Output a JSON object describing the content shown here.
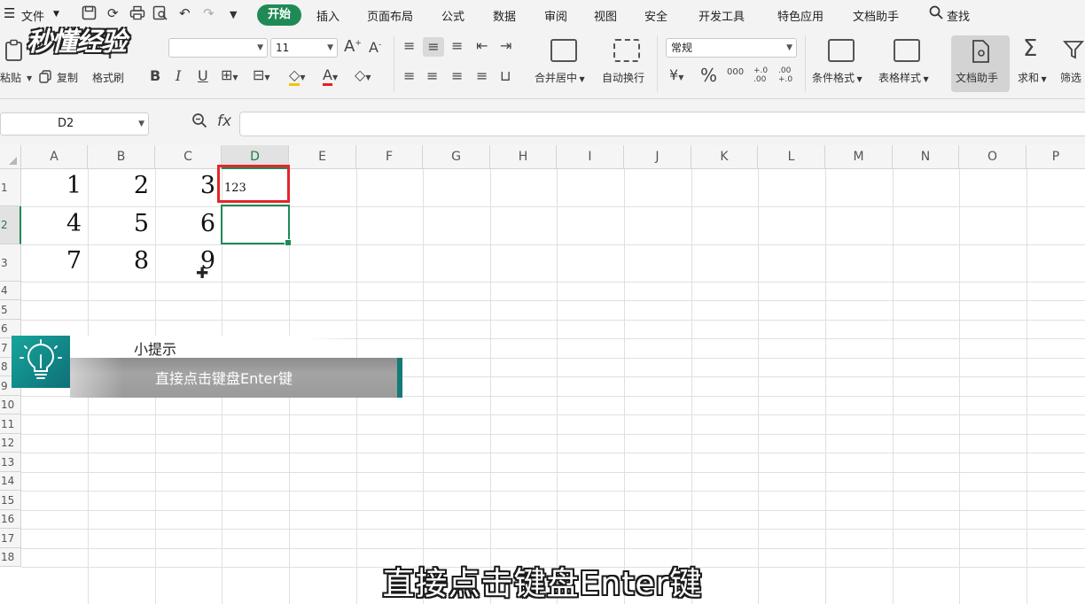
{
  "menubar": {
    "file_label": "文件",
    "tabs": [
      "开始",
      "插入",
      "页面布局",
      "公式",
      "数据",
      "审阅",
      "视图",
      "安全",
      "开发工具",
      "特色应用",
      "文档助手"
    ],
    "active_tab": "开始",
    "search_label": "查找"
  },
  "ribbon": {
    "paste_label": "粘贴",
    "copy_label": "复制",
    "format_painter_label": "格式刷",
    "font_size": "11",
    "merge_center_label": "合并居中",
    "wrap_text_label": "自动换行",
    "number_format": "常规",
    "cond_format_label": "条件格式",
    "table_style_label": "表格样式",
    "doc_assistant_label": "文档助手",
    "sum_label": "求和",
    "filter_label": "筛选",
    "bold_label": "B",
    "italic_label": "I",
    "underline_label": "U",
    "font_color_label": "A",
    "grow_font_label": "A",
    "shrink_font_label": "A",
    "percent_label": "%",
    "thousands_label": "000",
    "inc_decimal_label": "+.0 .00",
    "dec_decimal_label": ".00 +.0"
  },
  "formula_bar": {
    "cell_ref": "D2",
    "fx_label": "fx",
    "value": ""
  },
  "sheet": {
    "columns": [
      "A",
      "B",
      "C",
      "D",
      "E",
      "F",
      "G",
      "H",
      "I",
      "J",
      "K",
      "L",
      "M",
      "N",
      "O",
      "P"
    ],
    "rows": [
      "1",
      "2",
      "3",
      "4",
      "5",
      "6",
      "7",
      "8",
      "9",
      "10",
      "11",
      "12",
      "13",
      "14",
      "15",
      "16",
      "17",
      "18"
    ],
    "selected_column": "D",
    "selected_row": "2",
    "cells": {
      "A1": "1",
      "B1": "2",
      "C1": "3",
      "D1": "123",
      "A2": "4",
      "B2": "5",
      "C2": "6",
      "A3": "7",
      "B3": "8",
      "C3": "9"
    }
  },
  "tip": {
    "title": "小提示",
    "text": "直接点击键盘Enter键"
  },
  "subtitle": "直接点击键盘Enter键",
  "watermark": "秒懂经验",
  "colors": {
    "accent": "#1f8a55",
    "highlight_box": "#e3262b",
    "tip_teal": "#137b78"
  }
}
